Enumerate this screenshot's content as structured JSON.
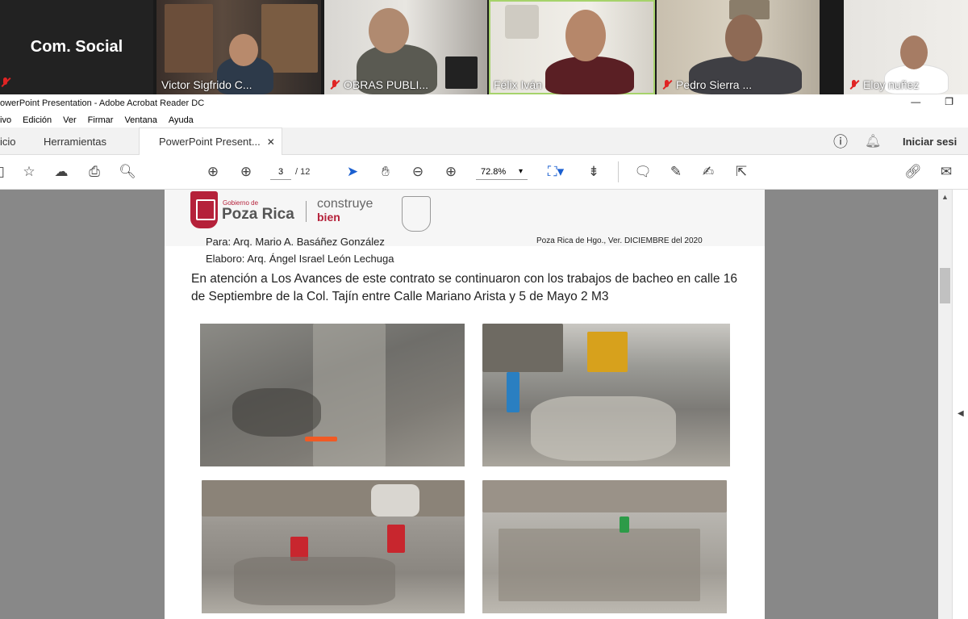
{
  "meeting": {
    "participants": [
      {
        "name": "Com. Social",
        "muted": true
      },
      {
        "name": "Victor Sigfrido C...",
        "muted": false
      },
      {
        "name": "OBRAS PUBLI...",
        "muted": true
      },
      {
        "name": "Félix Iván",
        "muted": false
      },
      {
        "name": "Pedro Sierra ...",
        "muted": true
      },
      {
        "name": "Eloy nuñez",
        "muted": true
      }
    ]
  },
  "app": {
    "title": "owerPoint Presentation - Adobe Acrobat Reader DC",
    "menu": [
      "ivo",
      "Edición",
      "Ver",
      "Firmar",
      "Ventana",
      "Ayuda"
    ],
    "tabs": {
      "home": "icio",
      "tools": "Herramientas",
      "doc": "PowerPoint Present..."
    },
    "signin": "Iniciar sesi",
    "page_current": "3",
    "page_total": "/ 12",
    "zoom": "72.8%"
  },
  "document": {
    "gobierno": "Gobierno de",
    "city": "Poza Rica",
    "slogan1": "construye",
    "slogan2": "bien",
    "to": "Para: Arq. Mario A. Basáñez González",
    "by": "Elaboro: Arq. Ángel Israel León Lechuga",
    "date": "Poza Rica de Hgo., Ver. DICIEMBRE del 2020",
    "body": "En atención a Los Avances de este contrato se continuaron con los trabajos de bacheo en calle 16 de Septiembre de la Col. Tajín entre Calle Mariano Arista y 5 de Mayo 2 M3"
  },
  "colors": {
    "accent": "#b5213a",
    "active_speaker": "#a6d36b",
    "muted": "#e02424"
  }
}
